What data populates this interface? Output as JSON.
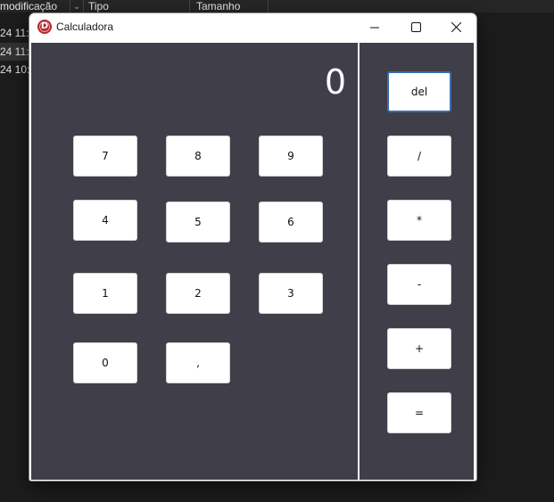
{
  "background_window": {
    "columns": [
      "modificação",
      "Tipo",
      "Tamanho"
    ],
    "rows": [
      "24 11:",
      "24 11:",
      "24 10:"
    ]
  },
  "window": {
    "title": "Calculadora",
    "icon": "app-logo-icon",
    "controls": {
      "minimize": "minimize-icon",
      "maximize": "maximize-icon",
      "close": "close-icon"
    }
  },
  "display": {
    "value": "0"
  },
  "keypad": {
    "digits": [
      "7",
      "8",
      "9",
      "4",
      "5",
      "6",
      "1",
      "2",
      "3",
      "0",
      ","
    ]
  },
  "operators": [
    "del",
    "/",
    "*",
    "-",
    "+",
    "="
  ],
  "colors": {
    "panel_background": "#403e48",
    "focus_border": "#3a6fb0",
    "app_icon": "#b3262d"
  }
}
